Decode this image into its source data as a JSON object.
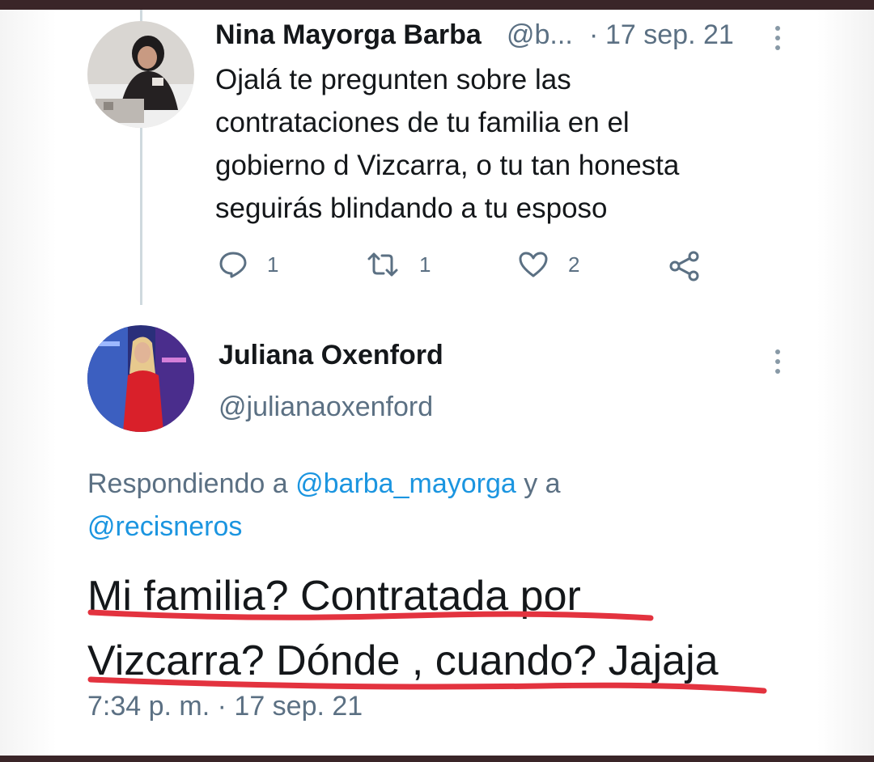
{
  "tweet1": {
    "name": "Nina Mayorga Barba",
    "handle": "@b...",
    "separator": "·",
    "date": "17 sep. 21",
    "text_lines": [
      "Ojalá te pregunten sobre las",
      "contrataciones de tu familia en el",
      "gobierno d Vizcarra, o tu tan honesta",
      "seguirás blindando a tu esposo"
    ],
    "actions": {
      "reply_icon": "reply-icon",
      "reply_count": "1",
      "retweet_icon": "retweet-icon",
      "retweet_count": "1",
      "like_icon": "heart-icon",
      "like_count": "2",
      "share_icon": "share-icon"
    }
  },
  "tweet2": {
    "name": "Juliana Oxenford",
    "handle": "@julianaoxenford",
    "replying_prefix": "Respondiendo a",
    "mention1": "@barba_mayorga",
    "replying_joiner": "y a",
    "mention2": "@recisneros",
    "text_lines": [
      "Mi familia? Contratada por",
      "Vizcarra? Dónde , cuando? Jajaja"
    ],
    "timestamp": "7:34 p. m. · 17 sep. 21"
  },
  "colors": {
    "text": "#14171a",
    "secondary": "#5b7083",
    "link": "#1b95e0",
    "underline": "#e3333f",
    "frame": "#3a2528"
  }
}
